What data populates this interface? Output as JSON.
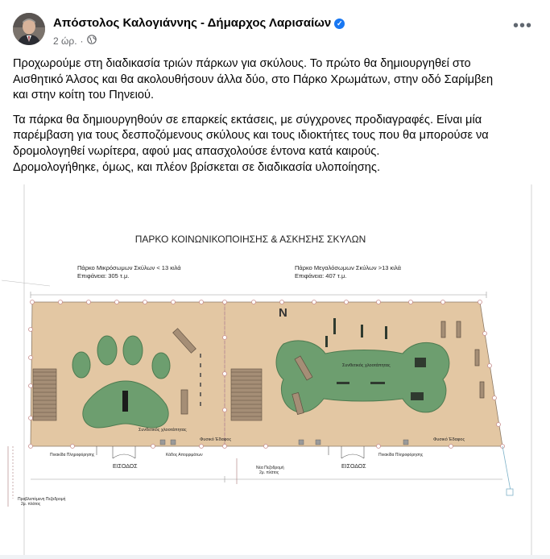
{
  "post": {
    "author": "Απόστολος Καλογιάννης - Δήμαρχος Λαρισαίων",
    "time": "2 ώρ.",
    "dot": "·",
    "paragraphs": [
      "Προχωρούμε στη διαδικασία τριών πάρκων για σκύλους. Το πρώτο θα δημιουργηθεί στο\nΑισθητικό Άλσος και θα ακολουθήσουν άλλα δύο, στο Πάρκο Χρωμάτων, στην οδό Σαρίμβεη\nκαι στην κοίτη του Πηνειού.",
      "Τα πάρκα θα δημιουργηθούν σε επαρκείς εκτάσεις, με σύγχρονες προδιαγραφές.  Είναι μία\nπαρέμβαση για τους δεσποζόμενους σκύλους και τους ιδιοκτήτες τους που θα μπορούσε να\nδρομολογηθεί νωρίτερα, αφού μας απασχολούσε έντονα κατά καιρούς.\n Δρομολογήθηκε, όμως, και πλέον βρίσκεται σε διαδικασία υλοποίησης."
    ]
  },
  "plan": {
    "title": "ΠΑΡΚΟ ΚΟΙΝΩΝΙΚΟΠΟΙΗΣΗΣ & ΑΣΚΗΣΗΣ ΣΚΥΛΩΝ",
    "left_name": "Πάρκο Μικρόσωμων Σκύλων < 13 κιλά",
    "left_area": "Επιφάνεια: 305 τ.μ.",
    "right_name": "Πάρκο Μεγαλόσωμων Σκύλων >13 κιλά",
    "right_area": "Επιφάνεια: 407 τ.μ.",
    "synthetic_grass_left": "Συνθετικός χλοοτάπητας",
    "synthetic_grass_right": "Συνθετικός χλοοτάπητας",
    "natural_floor_left": "Φυσικό Έδαφος",
    "natural_floor_right": "Φυσικό Έδαφος",
    "info_board_left": "Πινακίδα Πληροφόρησης",
    "bin": "Κάδος Απορριμάτων",
    "entrance_left": "ΕΙΣΟΔΟΣ",
    "entrance_right": "ΕΙΣΟΔΟΣ",
    "new_path": "Νέα Πεζοδρομή",
    "new_path_2": "2μ. πλάτος",
    "info_board_right": "Πινακίδα Πληροφόρησης",
    "existing_path": "Προβλεπόμενη Πεζοδρομή",
    "existing_path_2": "2μ. πλάτος",
    "north": "N",
    "colors": {
      "floor": "#e3c7a3",
      "grass": "#6d9e6f",
      "fence": "#c9a0a0"
    }
  }
}
